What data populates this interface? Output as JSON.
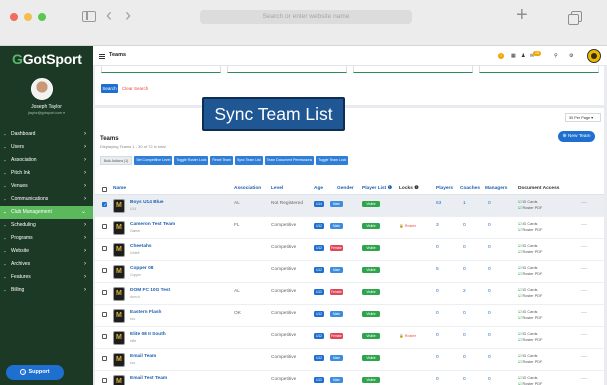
{
  "browser": {
    "url_placeholder": "Search or enter website name",
    "back": "‹",
    "forward": "›",
    "new_tab": "+"
  },
  "sidebar": {
    "logo_prefix": "Got",
    "logo_suffix": "Sport",
    "logo_icon": "G",
    "user_name": "Joseph Taylor",
    "user_email": "jtaylor@gotsport.com ▾",
    "menu": [
      {
        "label": "Dashboard",
        "icon": "▪",
        "active": false
      },
      {
        "label": "Users",
        "icon": "▪",
        "active": false
      },
      {
        "label": "Association",
        "icon": "▪",
        "active": false
      },
      {
        "label": "Pitch Ink",
        "icon": "▪",
        "active": false
      },
      {
        "label": "Venues",
        "icon": "▪",
        "active": false
      },
      {
        "label": "Communications",
        "icon": "▪",
        "active": false
      },
      {
        "label": "Club Management",
        "icon": "▪",
        "active": true
      },
      {
        "label": "Scheduling",
        "icon": "▪",
        "active": false
      },
      {
        "label": "Programs",
        "icon": "▪",
        "active": false
      },
      {
        "label": "Website",
        "icon": "▪",
        "active": false
      },
      {
        "label": "Archives",
        "icon": "▪",
        "active": false
      },
      {
        "label": "Features",
        "icon": "▪",
        "active": false
      },
      {
        "label": "Billing",
        "icon": "▪",
        "active": false
      }
    ],
    "support_label": "Support",
    "support_icon": "?"
  },
  "topbar": {
    "title": "Teams",
    "help_icon": "?",
    "grid_icon": "▦",
    "bell_icon": "♟",
    "mail_icon": "✉",
    "mail_badge": "18",
    "search_icon": "⚲",
    "settings_icon": "⚙"
  },
  "filter": {
    "search_label": "Search",
    "clear_label": "Clear Search"
  },
  "overlay_title": "Sync Team List",
  "list": {
    "per_page": "30 Per Page ▾",
    "heading": "Teams",
    "subtitle": "Displaying Teams 1 - 30 of 72 in total",
    "new_team_label": "⊕ New Team",
    "bulk_label": "Bulk Actions (1)",
    "bulk_actions": [
      "Set Competitive Level",
      "Toggle Roster Lock",
      "Reset Team",
      "Sync Team List",
      "Team Document Permissions",
      "Toggle Team Lock"
    ]
  },
  "columns": {
    "name": "Name",
    "association": "Association",
    "level": "Level",
    "age": "Age",
    "gender": "Gender",
    "player_list": "Player List ❶",
    "locks": "Locks ❶",
    "players": "Players",
    "coaches": "Coaches",
    "managers": "Managers",
    "docs": "Document Access"
  },
  "teams": [
    {
      "name": "Boys U14 Blue",
      "sub": "U14",
      "assoc": "AL",
      "level": "Not Registered",
      "age": "U14",
      "gender": "Male",
      "gender_color": "#3c8dde",
      "visible": "Visible",
      "lock": "",
      "players": "63",
      "coaches": "1",
      "managers": "0",
      "doc1": "ID Cards",
      "doc2": "Roster PDF",
      "selected": true
    },
    {
      "name": "Cameron Test Team",
      "sub": "Gamer",
      "assoc": "FL",
      "level": "Competitive",
      "age": "U12",
      "gender": "Male",
      "gender_color": "#3c8dde",
      "visible": "Visible",
      "lock": "🔒 Roster",
      "players": "3",
      "coaches": "0",
      "managers": "0",
      "doc1": "ID Cards",
      "doc2": "Roster PDF",
      "selected": false
    },
    {
      "name": "Cheetahs",
      "sub": "U/stell",
      "assoc": "",
      "level": "Competitive",
      "age": "U12",
      "gender": "Female",
      "gender_color": "#e04858",
      "visible": "Visible",
      "lock": "",
      "players": "0",
      "coaches": "0",
      "managers": "0",
      "doc1": "ID Cards",
      "doc2": "Roster PDF",
      "selected": false
    },
    {
      "name": "Copper 08",
      "sub": "Copper",
      "assoc": "",
      "level": "Competitive",
      "age": "U12",
      "gender": "Male",
      "gender_color": "#3c8dde",
      "visible": "Visible",
      "lock": "",
      "players": "5",
      "coaches": "0",
      "managers": "0",
      "doc1": "ID Cards",
      "doc2": "Roster PDF",
      "selected": false
    },
    {
      "name": "DOM FC 10G Test",
      "sub": "dom fc",
      "assoc": "AL",
      "level": "Competitive",
      "age": "U12",
      "gender": "Female",
      "gender_color": "#e04858",
      "visible": "Visible",
      "lock": "",
      "players": "0",
      "coaches": "2",
      "managers": "0",
      "doc1": "ID Cards",
      "doc2": "Roster PDF",
      "selected": false
    },
    {
      "name": "Eastern Flash",
      "sub": "ecc",
      "assoc": "OK",
      "level": "Competitive",
      "age": "U12",
      "gender": "Male",
      "gender_color": "#3c8dde",
      "visible": "Visible",
      "lock": "",
      "players": "0",
      "coaches": "0",
      "managers": "0",
      "doc1": "ID Cards",
      "doc2": "Roster PDF",
      "selected": false
    },
    {
      "name": "Elite 08 II South",
      "sub": "elite",
      "assoc": "",
      "level": "Competitive",
      "age": "U12",
      "gender": "Female",
      "gender_color": "#e04858",
      "visible": "Visible",
      "lock": "🔒 Roster",
      "players": "0",
      "coaches": "0",
      "managers": "0",
      "doc1": "ID Cards",
      "doc2": "Roster PDF",
      "selected": false
    },
    {
      "name": "Email Team",
      "sub": "ecc",
      "assoc": "",
      "level": "Competitive",
      "age": "U12",
      "gender": "Male",
      "gender_color": "#3c8dde",
      "visible": "Visible",
      "lock": "",
      "players": "0",
      "coaches": "0",
      "managers": "0",
      "doc1": "ID Cards",
      "doc2": "Roster PDF",
      "selected": false
    },
    {
      "name": "Email Test Team",
      "sub": "",
      "assoc": "",
      "level": "Competitive",
      "age": "U12",
      "gender": "Male",
      "gender_color": "#3c8dde",
      "visible": "Visible",
      "lock": "",
      "players": "0",
      "coaches": "0",
      "managers": "0",
      "doc1": "ID Cards",
      "doc2": "Roster PDF",
      "selected": false
    }
  ]
}
